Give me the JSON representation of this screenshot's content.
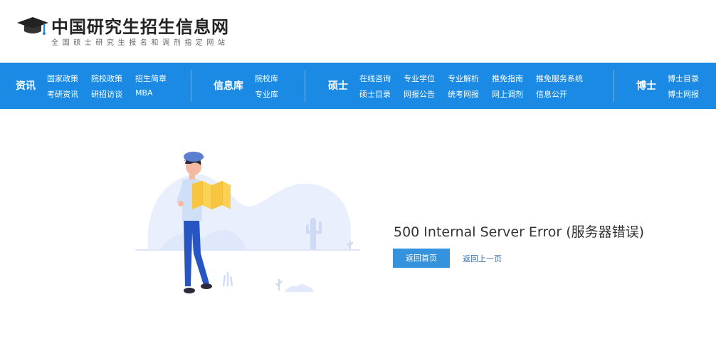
{
  "site": {
    "title": "中国研究生招生信息网",
    "subtitle": "全国硕士研究生报名和调剂指定网站"
  },
  "nav": {
    "zixun": {
      "label": "资讯",
      "links": [
        "国家政策",
        "院校政策",
        "招生简章",
        "考研资讯",
        "研招访谈",
        "MBA"
      ]
    },
    "xinxiku": {
      "label": "信息库",
      "links": [
        "院校库",
        "专业库"
      ]
    },
    "shuoshi": {
      "label": "硕士",
      "links": [
        "在线咨询",
        "专业学位",
        "专业解析",
        "推免指南",
        "推免服务系统",
        "硕士目录",
        "网报公告",
        "统考网报",
        "网上调剂",
        "信息公开"
      ]
    },
    "boshi": {
      "label": "博士",
      "links": [
        "博士目录",
        "博士网报"
      ]
    }
  },
  "error": {
    "title": "500 Internal Server Error (服务器错误)",
    "home_button": "返回首页",
    "back_link": "返回上一页"
  },
  "colors": {
    "nav_bg": "#1a8ae5",
    "button_bg": "#3592dd",
    "link": "#3a6da8"
  }
}
